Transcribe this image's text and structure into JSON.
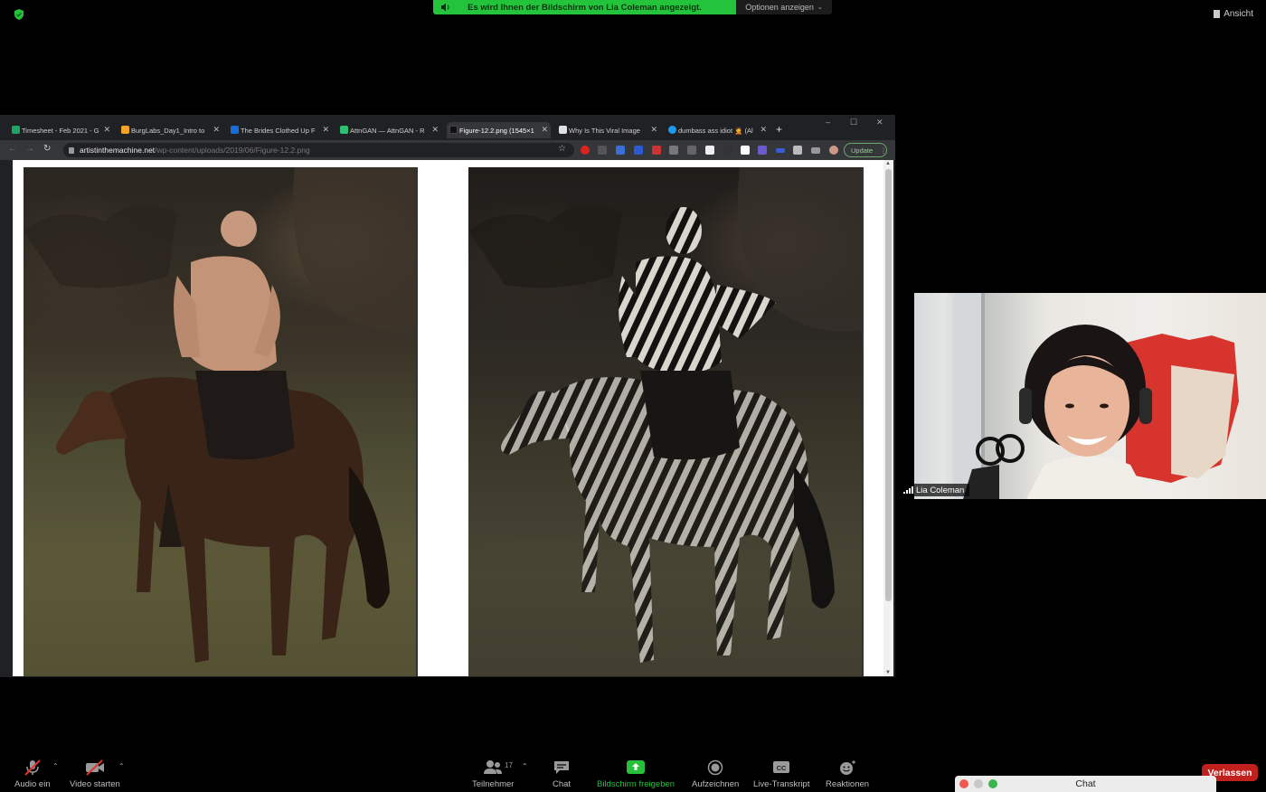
{
  "zoom_top": {
    "share_banner": "Es wird Ihnen der Bildschirm von Lia Coleman angezeigt.",
    "options": "Optionen anzeigen",
    "view": "Ansicht"
  },
  "browser": {
    "tabs": [
      {
        "label": "Timesheet - Feb 2021 - G",
        "color": "#1fa463"
      },
      {
        "label": "BurgLabs_Day1_Intro to",
        "color": "#f4a424"
      },
      {
        "label": "The Brides Clothed Up F",
        "color": "#1b6cd8"
      },
      {
        "label": "AttnGAN — AttnGAN - R",
        "color": "#2fbf71"
      },
      {
        "label": "Figure-12.2.png (1545×1",
        "color": "#111111"
      },
      {
        "label": "Why Is This Viral Image",
        "color": "#e0e0e0"
      },
      {
        "label": "dumbass ass idiot 🤦 (Al",
        "color": "#1d9bf0"
      }
    ],
    "url_host": "artistinthemachine.net",
    "url_path": "/wp-content/uploads/2019/06/Figure-12.2.png",
    "update_label": "Update"
  },
  "participant": {
    "name": "Lia Coleman"
  },
  "controls": {
    "audio": "Audio ein",
    "video": "Video starten",
    "participants": "Teilnehmer",
    "participants_count": "17",
    "chat": "Chat",
    "share": "Bildschirm freigeben",
    "record": "Aufzeichnen",
    "transcript": "Live-Transkript",
    "cc": "CC",
    "reactions": "Reaktionen",
    "leave": "Verlassen"
  },
  "chat_window": {
    "title": "Chat"
  }
}
